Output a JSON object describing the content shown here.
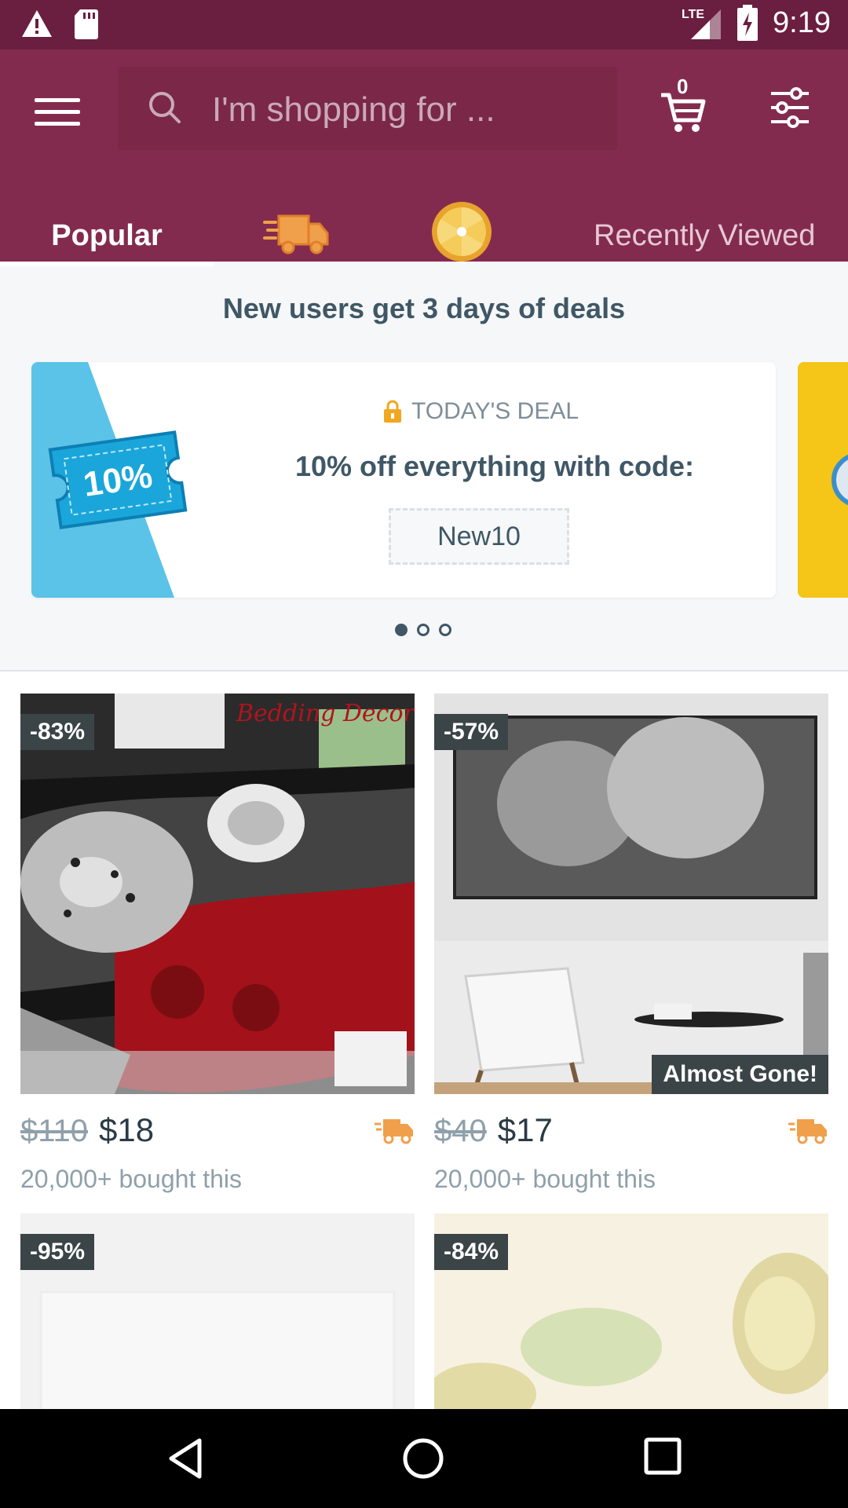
{
  "status_bar": {
    "time": "9:19",
    "network": "LTE"
  },
  "search": {
    "placeholder": "I'm shopping for ..."
  },
  "cart": {
    "count": "0"
  },
  "tabs": {
    "popular": "Popular",
    "recently_viewed": "Recently Viewed"
  },
  "deals": {
    "title": "New users get 3 days of deals",
    "ticket_text": "10%",
    "label": "TODAY'S DEAL",
    "headline": "10% off everything with code:",
    "code": "New10",
    "pager": {
      "total": 3,
      "active": 1
    }
  },
  "products": [
    {
      "discount": "-83%",
      "old_price": "$110",
      "new_price": "$18",
      "sold": "20,000+ bought this",
      "image_text": "Bedding Decor"
    },
    {
      "discount": "-57%",
      "old_price": "$40",
      "new_price": "$17",
      "sold": "20,000+ bought this",
      "tag": "Almost Gone!"
    },
    {
      "discount": "-95%"
    },
    {
      "discount": "-84%"
    }
  ],
  "colors": {
    "status_bar": "#6a1e40",
    "app_bar": "#832b4f",
    "accent_orange": "#f0a04a",
    "text_dark": "#3f5766",
    "text_muted": "#8fa0aa"
  }
}
